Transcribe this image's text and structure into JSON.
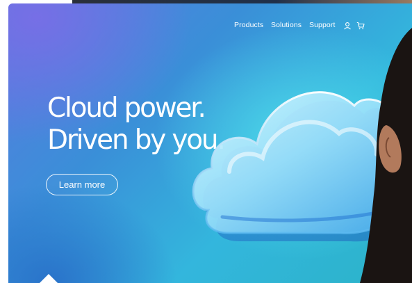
{
  "nav": {
    "items": [
      {
        "label": "Products"
      },
      {
        "label": "Solutions"
      },
      {
        "label": "Support"
      }
    ],
    "icons": [
      "user-icon",
      "cart-icon"
    ]
  },
  "hero": {
    "title_line1": "Cloud power.",
    "title_line2": "Driven by you.",
    "cta_label": "Learn more"
  },
  "colors": {
    "gradient_top_left": "#6a6fe0",
    "gradient_center": "#3a8fd8",
    "gradient_right": "#33c0dd",
    "text": "#ffffff"
  }
}
